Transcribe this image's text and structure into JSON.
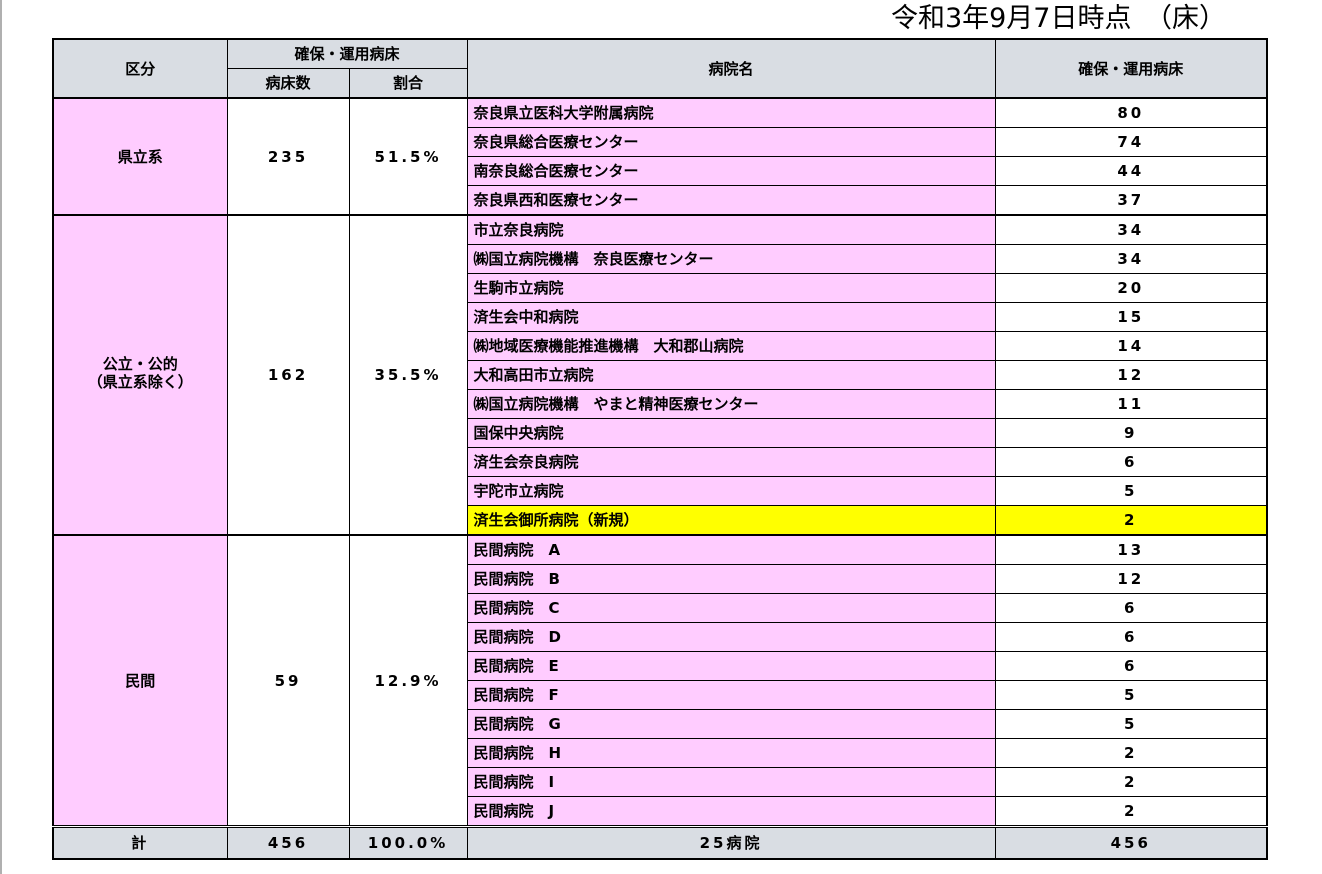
{
  "date_line": "令和3年9月7日時点　（床）",
  "headers": {
    "category": "区分",
    "secured_group": "確保・運用病床",
    "bed_count": "病床数",
    "ratio": "割合",
    "hospital_name": "病院名",
    "secured_beds": "確保・運用病床"
  },
  "groups": [
    {
      "category": "県立系",
      "category_line2": "",
      "bed_count": "235",
      "ratio": "51.5%",
      "hospitals": [
        {
          "name": "奈良県立医科大学附属病院",
          "beds": "80"
        },
        {
          "name": "奈良県総合医療センター",
          "beds": "74"
        },
        {
          "name": "南奈良総合医療センター",
          "beds": "44"
        },
        {
          "name": "奈良県西和医療センター",
          "beds": "37"
        }
      ]
    },
    {
      "category": "公立・公的",
      "category_line2": "（県立系除く）",
      "bed_count": "162",
      "ratio": "35.5%",
      "hospitals": [
        {
          "name": "市立奈良病院",
          "beds": "34"
        },
        {
          "name": "㈱国立病院機構　奈良医療センター",
          "beds": "34"
        },
        {
          "name": "生駒市立病院",
          "beds": "20"
        },
        {
          "name": "済生会中和病院",
          "beds": "15"
        },
        {
          "name": "㈱地域医療機能推進機構　大和郡山病院",
          "beds": "14"
        },
        {
          "name": "大和高田市立病院",
          "beds": "12"
        },
        {
          "name": "㈱国立病院機構　やまと精神医療センター",
          "beds": "11"
        },
        {
          "name": "国保中央病院",
          "beds": "9"
        },
        {
          "name": "済生会奈良病院",
          "beds": "6"
        },
        {
          "name": "宇陀市立病院",
          "beds": "5"
        },
        {
          "name": "済生会御所病院（新規）",
          "beds": "2",
          "highlight": true
        }
      ]
    },
    {
      "category": "民間",
      "category_line2": "",
      "bed_count": "59",
      "ratio": "12.9%",
      "hospitals": [
        {
          "name": "民間病院　A",
          "beds": "13"
        },
        {
          "name": "民間病院　B",
          "beds": "12"
        },
        {
          "name": "民間病院　C",
          "beds": "6"
        },
        {
          "name": "民間病院　D",
          "beds": "6"
        },
        {
          "name": "民間病院　E",
          "beds": "6"
        },
        {
          "name": "民間病院　F",
          "beds": "5"
        },
        {
          "name": "民間病院　G",
          "beds": "5"
        },
        {
          "name": "民間病院　H",
          "beds": "2"
        },
        {
          "name": "民間病院　I",
          "beds": "2"
        },
        {
          "name": "民間病院　J",
          "beds": "2"
        }
      ]
    }
  ],
  "totals": {
    "label": "計",
    "bed_count": "456",
    "ratio": "100.0%",
    "hospital_count": "25病院",
    "secured_beds": "456"
  },
  "colors": {
    "category_fill": "#ffccff",
    "header_fill": "#d9dde3",
    "highlight_fill": "#ffff00"
  }
}
